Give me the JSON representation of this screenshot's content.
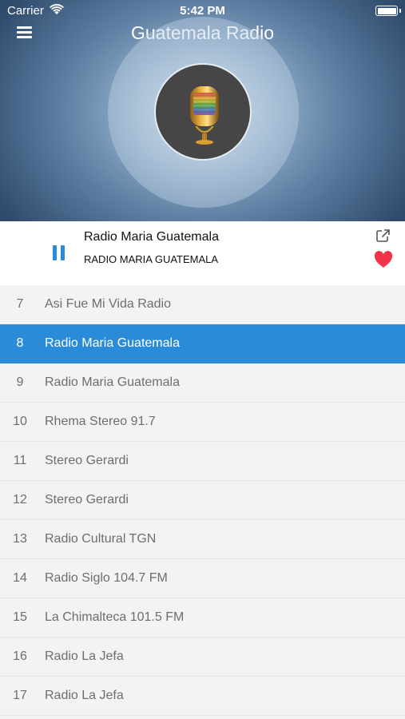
{
  "status_bar": {
    "carrier": "Carrier",
    "time": "5:42 PM"
  },
  "header": {
    "title": "Guatemala Radio",
    "menu_icon": "hamburger-menu-icon"
  },
  "now_playing": {
    "title": "Radio Maria Guatemala",
    "subtitle": "RADIO MARIA GUATEMALA",
    "state": "playing",
    "accent_color": "#2a8bd8",
    "favorite_color": "#f0344a"
  },
  "stations": [
    {
      "num": "7",
      "name": "Asi Fue Mi Vida Radio"
    },
    {
      "num": "8",
      "name": "Radio Maria Guatemala",
      "active": true
    },
    {
      "num": "9",
      "name": "Radio Maria Guatemala"
    },
    {
      "num": "10",
      "name": "Rhema Stereo 91.7"
    },
    {
      "num": "11",
      "name": "Stereo Gerardi"
    },
    {
      "num": "12",
      "name": "Stereo Gerardi"
    },
    {
      "num": "13",
      "name": "Radio Cultural TGN"
    },
    {
      "num": "14",
      "name": "Radio Siglo 104.7 FM"
    },
    {
      "num": "15",
      "name": "La Chimalteca 101.5 FM"
    },
    {
      "num": "16",
      "name": "Radio La Jefa"
    },
    {
      "num": "17",
      "name": "Radio La Jefa"
    }
  ]
}
